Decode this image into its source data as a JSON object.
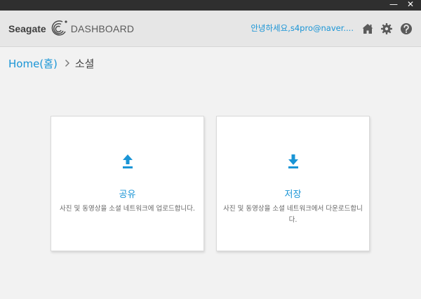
{
  "window": {
    "minimize_glyph": "—",
    "close_glyph": "✕"
  },
  "header": {
    "brand_name": "Seagate",
    "product_name": "DASHBOARD",
    "greeting": "안녕하세요,s4pro@naver....",
    "icons": [
      "home-icon",
      "gear-icon",
      "help-icon"
    ]
  },
  "breadcrumb": {
    "home": "Home(홈)",
    "separator_icon": "chevron-right-icon",
    "current": "소셜"
  },
  "cards": {
    "share": {
      "icon": "upload-arrow-icon",
      "title": "공유",
      "description": "사진 및 동영상을 소셜 네트워크에 업로드합니다."
    },
    "save": {
      "icon": "download-arrow-icon",
      "title": "저장",
      "description": "사진 및 동영상을 소셜 네트워크에서 다운로드합니다."
    }
  },
  "colors": {
    "accent": "#1a95d6",
    "header_bg": "#e6e6e6",
    "titlebar_bg": "#2f2f2f",
    "page_bg": "#f2f2f2"
  }
}
